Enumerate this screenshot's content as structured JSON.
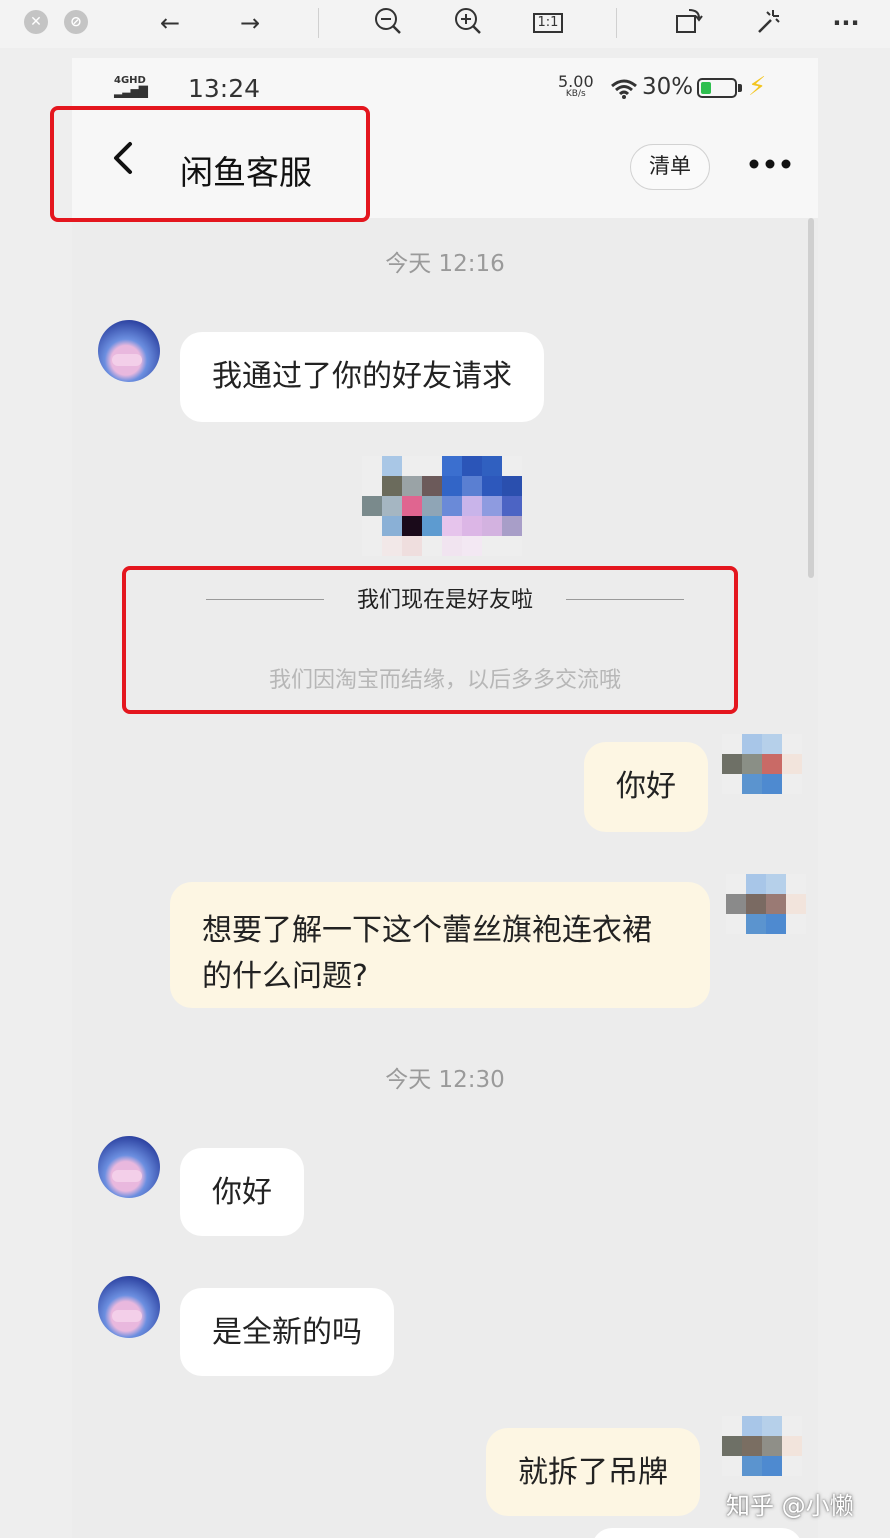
{
  "toolbar": {
    "icons": [
      "close-icon",
      "block-icon",
      "back-arrow-icon",
      "forward-arrow-icon",
      "zoom-out-icon",
      "zoom-in-icon",
      "actual-size-icon",
      "rotate-icon",
      "magic-wand-icon",
      "more-icon"
    ],
    "actual_size_label": "1:1"
  },
  "status_bar": {
    "network": "4GHD",
    "time": "13:24",
    "speed_value": "5.00",
    "speed_unit": "KB/s",
    "battery": "30%",
    "battery_level": 0.3
  },
  "header": {
    "back_icon": "back-chevron-icon",
    "title": "闲鱼客服",
    "list_button": "清单",
    "more_icon": "more-dots-icon"
  },
  "chat": {
    "timestamp_1": "今天  12:16",
    "msg_1": "我通过了你的好友请求",
    "friend_notice_title": "我们现在是好友啦",
    "friend_notice_sub": "我们因淘宝而结缘，以后多多交流哦",
    "msg_2": "你好",
    "msg_3": "想要了解一下这个蕾丝旗袍连衣裙的什么问题?",
    "timestamp_2": "今天  12:30",
    "msg_4": "你好",
    "msg_5": "是全新的吗",
    "msg_6": "就拆了吊牌"
  },
  "watermark": "知乎 @小懒",
  "colors": {
    "highlight_box": "#e4161e",
    "left_bubble": "#ffffff",
    "right_bubble": "#fdf6e3",
    "background": "#ececec"
  }
}
